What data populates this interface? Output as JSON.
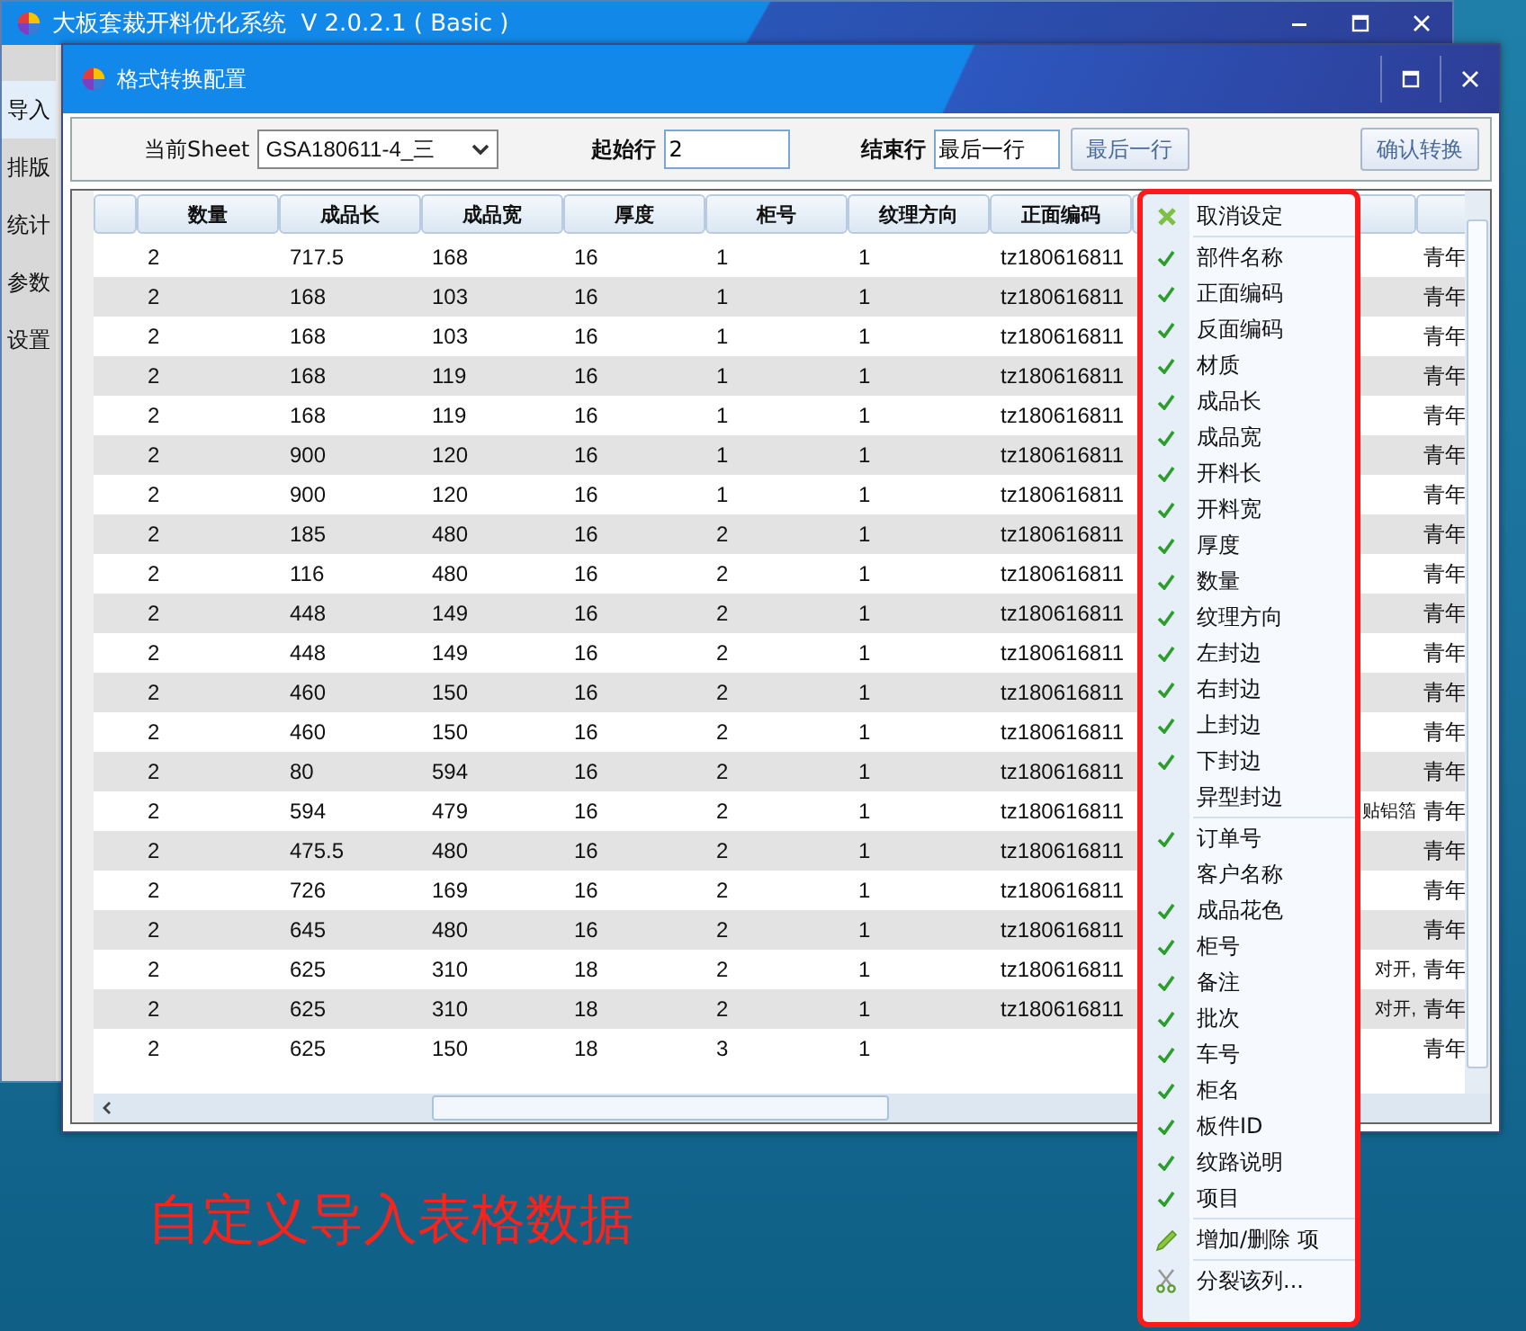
{
  "main_window": {
    "title": "大板套裁开料优化系统  V 2.0.2.1 ( Basic )"
  },
  "sidebar": {
    "items": [
      {
        "label": "导入",
        "selected": true
      },
      {
        "label": "排版",
        "selected": false
      },
      {
        "label": "统计",
        "selected": false
      },
      {
        "label": "参数",
        "selected": false
      },
      {
        "label": "设置",
        "selected": false
      }
    ]
  },
  "dialog": {
    "title": "格式转换配置",
    "toolbar": {
      "sheet_label": "当前Sheet",
      "sheet_value": "GSA180611-4_三",
      "start_label": "起始行",
      "start_value": "2",
      "end_label": "结束行",
      "end_value": "最后一行",
      "last_row_button": "最后一行",
      "confirm_button": "确认转换"
    },
    "table": {
      "columns": [
        "数量",
        "成品长",
        "成品宽",
        "厚度",
        "柜号",
        "纹理方向",
        "正面编码"
      ],
      "rows": [
        {
          "cells": [
            "2",
            "717.5",
            "168",
            "16",
            "1",
            "1",
            "tz180616811"
          ],
          "column_9": "青年"
        },
        {
          "cells": [
            "2",
            "168",
            "103",
            "16",
            "1",
            "1",
            "tz180616811"
          ],
          "column_9": "青年"
        },
        {
          "cells": [
            "2",
            "168",
            "103",
            "16",
            "1",
            "1",
            "tz180616811"
          ],
          "column_9": "青年"
        },
        {
          "cells": [
            "2",
            "168",
            "119",
            "16",
            "1",
            "1",
            "tz180616811"
          ],
          "column_9": "青年"
        },
        {
          "cells": [
            "2",
            "168",
            "119",
            "16",
            "1",
            "1",
            "tz180616811"
          ],
          "column_9": "青年"
        },
        {
          "cells": [
            "2",
            "900",
            "120",
            "16",
            "1",
            "1",
            "tz180616811"
          ],
          "column_9": "青年"
        },
        {
          "cells": [
            "2",
            "900",
            "120",
            "16",
            "1",
            "1",
            "tz180616811"
          ],
          "column_9": "青年"
        },
        {
          "cells": [
            "2",
            "185",
            "480",
            "16",
            "2",
            "1",
            "tz180616811"
          ],
          "column_9": "青年"
        },
        {
          "cells": [
            "2",
            "116",
            "480",
            "16",
            "2",
            "1",
            "tz180616811"
          ],
          "column_9": "青年"
        },
        {
          "cells": [
            "2",
            "448",
            "149",
            "16",
            "2",
            "1",
            "tz180616811"
          ],
          "column_9": "青年"
        },
        {
          "cells": [
            "2",
            "448",
            "149",
            "16",
            "2",
            "1",
            "tz180616811"
          ],
          "column_9": "青年"
        },
        {
          "cells": [
            "2",
            "460",
            "150",
            "16",
            "2",
            "1",
            "tz180616811"
          ],
          "column_9": "青年"
        },
        {
          "cells": [
            "2",
            "460",
            "150",
            "16",
            "2",
            "1",
            "tz180616811"
          ],
          "column_9": "青年"
        },
        {
          "cells": [
            "2",
            "80",
            "594",
            "16",
            "2",
            "1",
            "tz180616811"
          ],
          "column_9": "青年"
        },
        {
          "cells": [
            "2",
            "594",
            "479",
            "16",
            "2",
            "1",
            "tz180616811"
          ],
          "column_8": "贴铝箔",
          "column_9": "青年"
        },
        {
          "cells": [
            "2",
            "475.5",
            "480",
            "16",
            "2",
            "1",
            "tz180616811"
          ],
          "column_9": "青年"
        },
        {
          "cells": [
            "2",
            "726",
            "169",
            "16",
            "2",
            "1",
            "tz180616811"
          ],
          "column_9": "青年"
        },
        {
          "cells": [
            "2",
            "645",
            "480",
            "16",
            "2",
            "1",
            "tz180616811"
          ],
          "column_9": "青年"
        },
        {
          "cells": [
            "2",
            "625",
            "310",
            "18",
            "2",
            "1",
            "tz180616811"
          ],
          "column_8": "对开,",
          "column_9": "青年"
        },
        {
          "cells": [
            "2",
            "625",
            "310",
            "18",
            "2",
            "1",
            "tz180616811"
          ],
          "column_8": "对开,",
          "column_9": "青年"
        },
        {
          "cells": [
            "2",
            "625",
            "150",
            "18",
            "3",
            "1"
          ],
          "column_9": "青年"
        }
      ]
    }
  },
  "menu": {
    "items": [
      {
        "label": "取消设定",
        "kind": "cancel",
        "divider_after": true
      },
      {
        "label": "部件名称",
        "kind": "field",
        "checked": true
      },
      {
        "label": "正面编码",
        "kind": "field",
        "checked": true
      },
      {
        "label": "反面编码",
        "kind": "field",
        "checked": true
      },
      {
        "label": "材质",
        "kind": "field",
        "checked": true
      },
      {
        "label": "成品长",
        "kind": "field",
        "checked": true
      },
      {
        "label": "成品宽",
        "kind": "field",
        "checked": true
      },
      {
        "label": "开料长",
        "kind": "field",
        "checked": true
      },
      {
        "label": "开料宽",
        "kind": "field",
        "checked": true
      },
      {
        "label": "厚度",
        "kind": "field",
        "checked": true
      },
      {
        "label": "数量",
        "kind": "field",
        "checked": true
      },
      {
        "label": "纹理方向",
        "kind": "field",
        "checked": true
      },
      {
        "label": "左封边",
        "kind": "field",
        "checked": true
      },
      {
        "label": "右封边",
        "kind": "field",
        "checked": true
      },
      {
        "label": "上封边",
        "kind": "field",
        "checked": true
      },
      {
        "label": "下封边",
        "kind": "field",
        "checked": true
      },
      {
        "label": "异型封边",
        "kind": "field",
        "checked": false,
        "divider_after": true
      },
      {
        "label": "订单号",
        "kind": "field",
        "checked": true
      },
      {
        "label": "客户名称",
        "kind": "field",
        "checked": false
      },
      {
        "label": "成品花色",
        "kind": "field",
        "checked": true
      },
      {
        "label": "柜号",
        "kind": "field",
        "checked": true
      },
      {
        "label": "备注",
        "kind": "field",
        "checked": true
      },
      {
        "label": "批次",
        "kind": "field",
        "checked": true
      },
      {
        "label": "车号",
        "kind": "field",
        "checked": true
      },
      {
        "label": "柜名",
        "kind": "field",
        "checked": true
      },
      {
        "label": "板件ID",
        "kind": "field",
        "checked": true
      },
      {
        "label": "纹路说明",
        "kind": "field",
        "checked": true
      },
      {
        "label": "项目",
        "kind": "field",
        "checked": true,
        "divider_after": true
      },
      {
        "label": "增加/删除 项",
        "kind": "edit",
        "divider_after": true
      },
      {
        "label": "分裂该列...",
        "kind": "split"
      }
    ]
  },
  "caption": "自定义导入表格数据"
}
